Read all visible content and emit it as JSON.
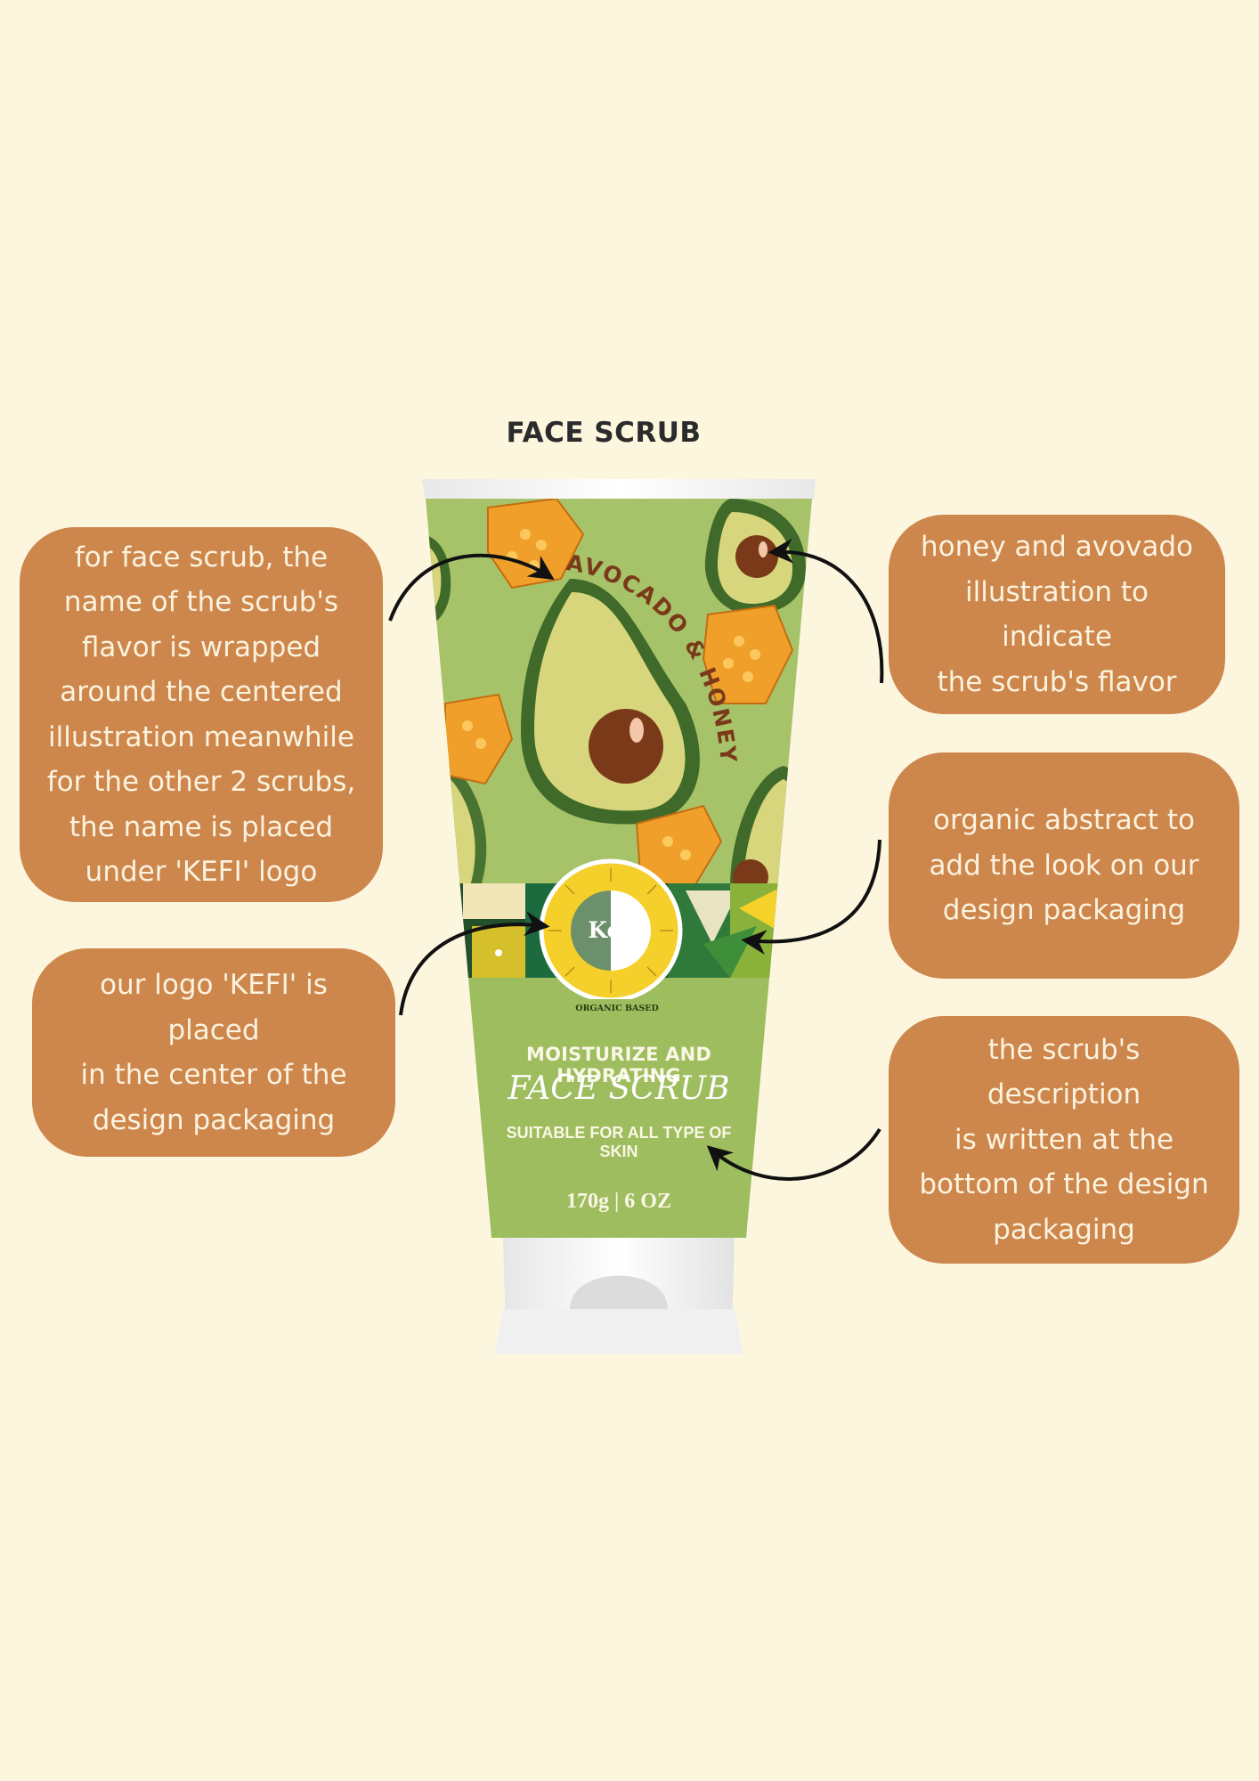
{
  "page": {
    "title": "FACE SCRUB"
  },
  "callouts": {
    "flavor_name": "for face scrub, the\nname of the scrub's\nflavor  is wrapped\naround the centered\nillustration meanwhile\nfor the other 2 scrubs,\nthe name is placed\nunder 'KEFI' logo",
    "logo": "our logo 'KEFI' is placed\nin the center of the\ndesign packaging",
    "illustration": "honey and avovado\nillustration to indicate\nthe scrub's flavor",
    "abstract": "organic abstract to\nadd the look on our\ndesign packaging",
    "description": "the scrub's description\nis written at the\nbottom of the design\npackaging"
  },
  "product": {
    "flavor_label": "AVOCADO & HONEY",
    "logo_text": "Kefi",
    "badge": "ORGANIC BASED",
    "tagline": "MOISTURIZE AND HYDRATING",
    "name": "FACE SCRUB",
    "suitability": "SUITABLE FOR ALL TYPE OF SKIN",
    "weight": "170g | 6 OZ"
  },
  "colors": {
    "background": "#fdf6df",
    "callout": "#cd864b",
    "tube_green": "#9dbd5e",
    "avocado_flesh": "#d8d67c",
    "avocado_pit": "#7a3a1a",
    "honey": "#f0a02a",
    "logo_yellow": "#f5cf2a"
  }
}
